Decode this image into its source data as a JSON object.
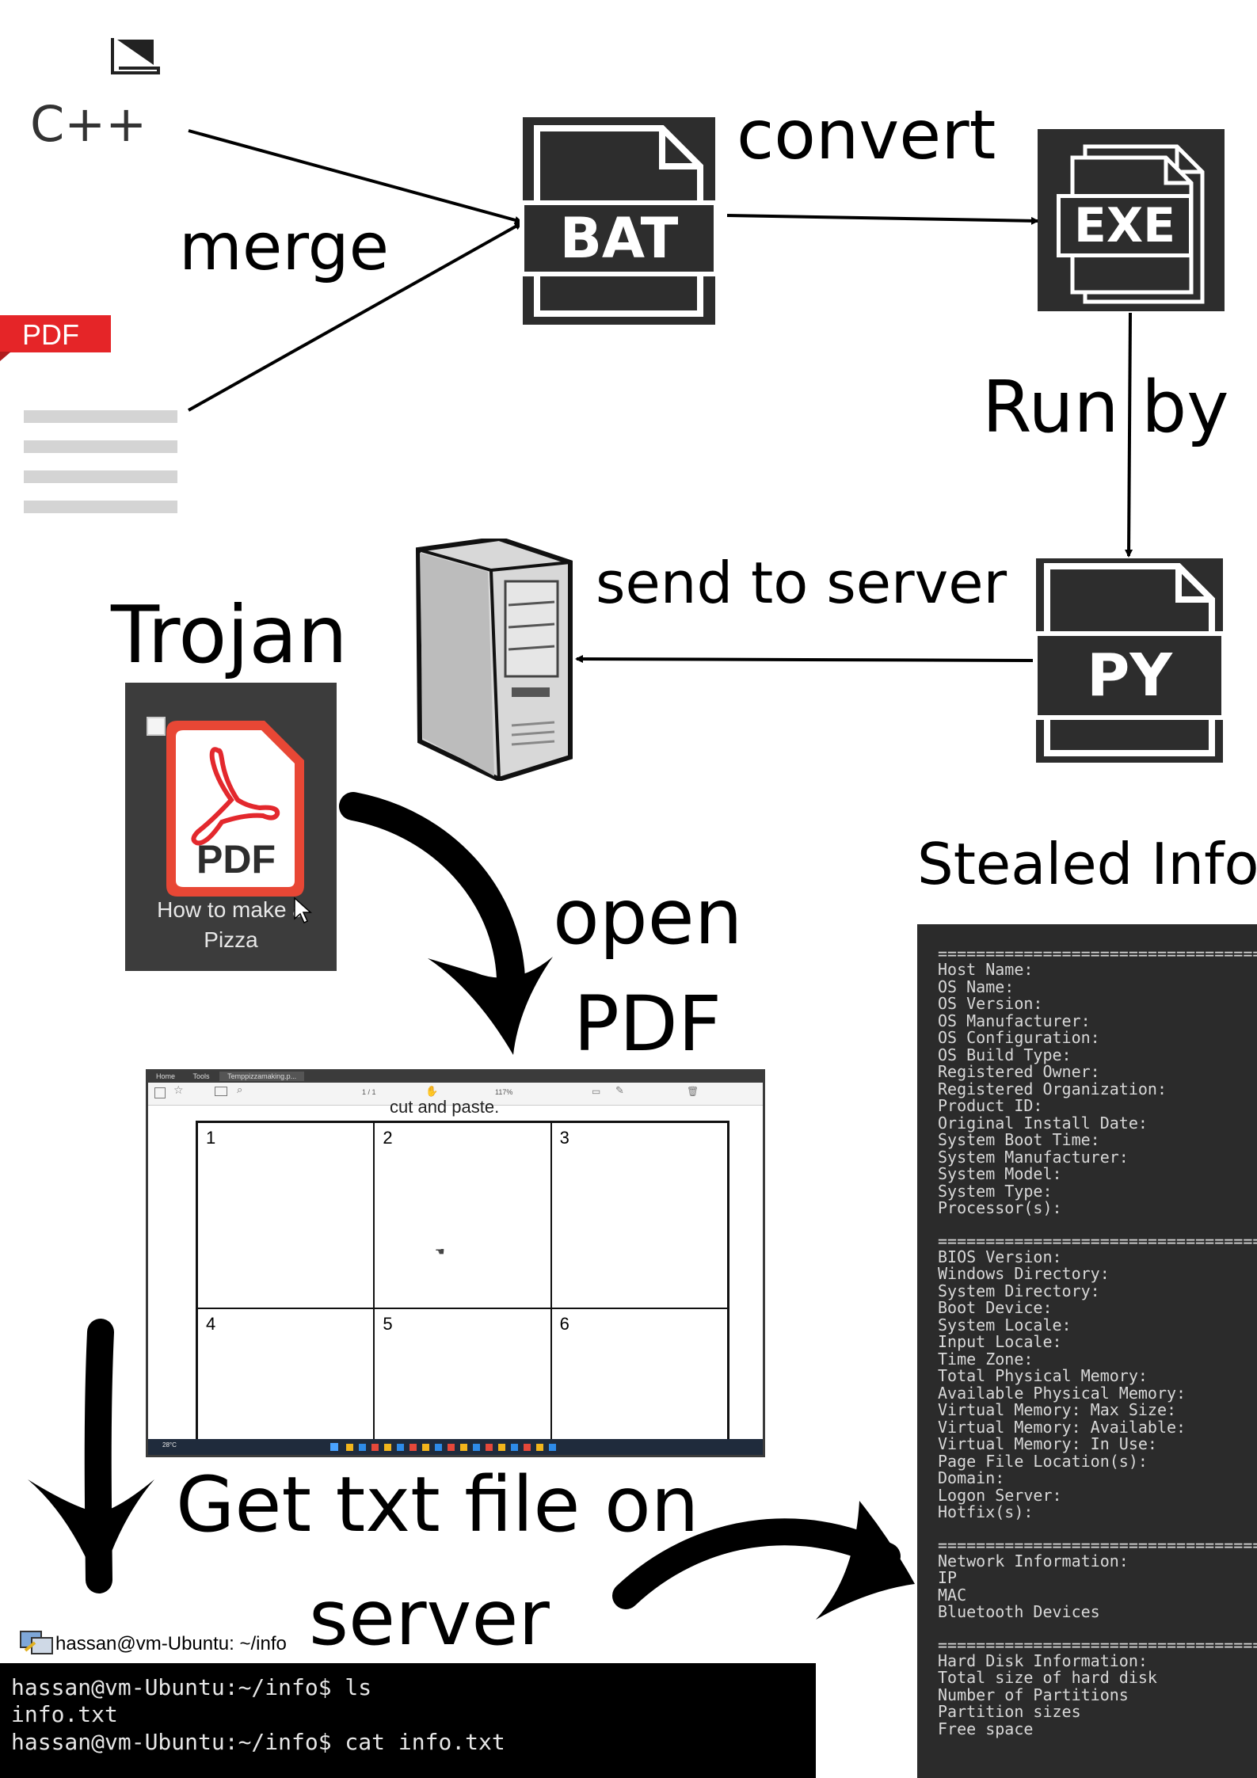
{
  "labels": {
    "cpp": "C++",
    "pdf_tag": "PDF",
    "merge": "merge",
    "convert": "convert",
    "run_by": "Run by",
    "send_to_server": "send to server",
    "trojan": "Trojan",
    "open_pdf_line1": "open",
    "open_pdf_line2": "PDF",
    "stealed_info": "Stealed Info",
    "get_txt_line1": "Get txt file on",
    "get_txt_line2": "server"
  },
  "files": {
    "bat": "BAT",
    "exe": "EXE",
    "py": "PY"
  },
  "trojan_icon": {
    "badge": "PDF",
    "caption_line1": "How to make a",
    "caption_line2": "Pizza"
  },
  "viewer": {
    "tabs": [
      "Home",
      "Tools",
      "Temppizzamaking.p..."
    ],
    "page_indicator": "1 / 1",
    "zoom": "117%",
    "header_text": "cut and paste.",
    "cells": [
      "1",
      "2",
      "3",
      "4",
      "5",
      "6"
    ],
    "weather": "28°C"
  },
  "terminal": {
    "title": "hassan@vm-Ubuntu: ~/info",
    "lines": [
      "hassan@vm-Ubuntu:~/info$ ls",
      "info.txt",
      "hassan@vm-Ubuntu:~/info$ cat info.txt"
    ]
  },
  "info_panel": {
    "separator": "============================================",
    "groups": [
      [
        "Host Name:",
        "OS Name:",
        "OS Version:",
        "OS Manufacturer:",
        "OS Configuration:",
        "OS Build Type:",
        "Registered Owner:",
        "Registered Organization:",
        "Product ID:",
        "Original Install Date:",
        "System Boot Time:",
        "System Manufacturer:",
        "System Model:",
        "System Type:",
        "Processor(s):"
      ],
      [
        "BIOS Version:",
        "Windows Directory:",
        "System Directory:",
        "Boot Device:",
        "System Locale:",
        "Input Locale:",
        "Time Zone:",
        "Total Physical Memory:",
        "Available Physical Memory:",
        "Virtual Memory: Max Size:",
        "Virtual Memory: Available:",
        "Virtual Memory: In Use:",
        "Page File Location(s):",
        "Domain:",
        "Logon Server:",
        "Hotfix(s):"
      ],
      [
        "Network Information:",
        "IP",
        "MAC",
        "Bluetooth Devices"
      ],
      [
        "Hard Disk Information:",
        "Total size of hard disk",
        "Number of Partitions",
        "Partition sizes",
        "Free space"
      ]
    ]
  }
}
